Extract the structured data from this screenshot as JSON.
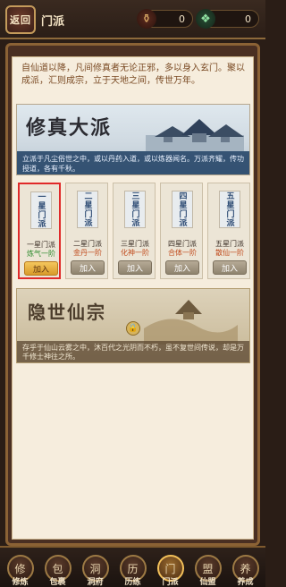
{
  "header": {
    "back_label": "返回",
    "title": "门派",
    "currencies": [
      {
        "icon": "gourd-icon",
        "value": "0"
      },
      {
        "icon": "jade-icon",
        "value": "0"
      }
    ]
  },
  "intro_text": "自仙道以降，凡间修真者无论正邪，多以身入玄门。聚以成派，汇则成宗，立于天地之间，传世万年。",
  "banner": {
    "title": "修真大派",
    "description": "立派于凡尘俗世之中，或以丹药入道，或以炼器闻名。万派齐耀，传功授道，各有千秋。"
  },
  "sects": [
    {
      "plaque": "一星门派",
      "name": "一星门派",
      "requirement": "炼气一阶",
      "join_label": "加入",
      "selected": true
    },
    {
      "plaque": "二星门派",
      "name": "二星门派",
      "requirement": "金丹一阶",
      "join_label": "加入",
      "selected": false
    },
    {
      "plaque": "三星门派",
      "name": "三星门派",
      "requirement": "化神一阶",
      "join_label": "加入",
      "selected": false
    },
    {
      "plaque": "四星门派",
      "name": "四星门派",
      "requirement": "合体一阶",
      "join_label": "加入",
      "selected": false
    },
    {
      "plaque": "五星门派",
      "name": "五星门派",
      "requirement": "散仙一阶",
      "join_label": "加入",
      "selected": false
    }
  ],
  "hidden_sect": {
    "title": "隐世仙宗",
    "description": "存乎于仙山云雾之中，沐百代之光阴而不朽，虽不复世间传说，却是万千修士神往之所。"
  },
  "bottom_nav": [
    {
      "label": "修炼",
      "icon": "cultivator-icon",
      "glyph": "修"
    },
    {
      "label": "包裹",
      "icon": "bag-icon",
      "glyph": "包"
    },
    {
      "label": "洞府",
      "icon": "cave-icon",
      "glyph": "洞"
    },
    {
      "label": "历练",
      "icon": "journey-icon",
      "glyph": "历"
    },
    {
      "label": "门派",
      "icon": "sect-icon",
      "glyph": "门",
      "active": true
    },
    {
      "label": "仙盟",
      "icon": "alliance-icon",
      "glyph": "盟"
    },
    {
      "label": "养成",
      "icon": "growth-icon",
      "glyph": "养"
    }
  ]
}
